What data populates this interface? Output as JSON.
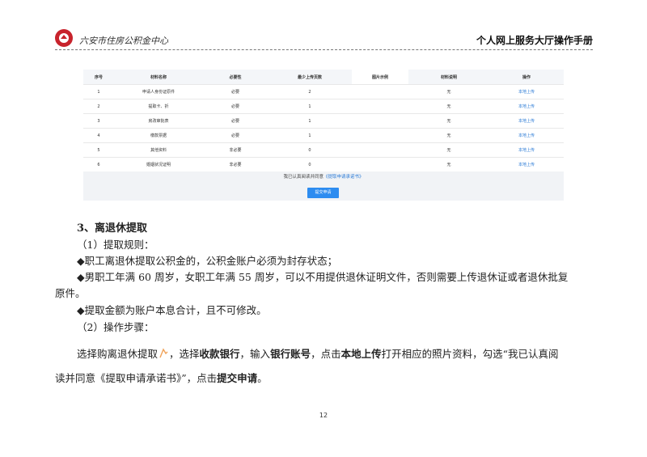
{
  "header": {
    "org_name": "六安市住房公积金中心",
    "doc_title": "个人网上服务大厅操作手册"
  },
  "screenshot": {
    "columns": [
      "序号",
      "材料名称",
      "必要性",
      "最少上传页数",
      "图片示例",
      "材料说明",
      "操作"
    ],
    "rows": [
      {
        "no": "1",
        "name": "申请人身份证原件",
        "required": "必要",
        "min_pages": "2",
        "desc": "无",
        "action": "本地上传"
      },
      {
        "no": "2",
        "name": "提取卡、折",
        "required": "必要",
        "min_pages": "1",
        "desc": "无",
        "action": "本地上传"
      },
      {
        "no": "3",
        "name": "房改审批表",
        "required": "必要",
        "min_pages": "1",
        "desc": "无",
        "action": "本地上传"
      },
      {
        "no": "4",
        "name": "缴款票据",
        "required": "必要",
        "min_pages": "1",
        "desc": "无",
        "action": "本地上传"
      },
      {
        "no": "5",
        "name": "其他资料",
        "required": "非必要",
        "min_pages": "0",
        "desc": "无",
        "action": "本地上传"
      },
      {
        "no": "6",
        "name": "婚姻状况证明",
        "required": "非必要",
        "min_pages": "0",
        "desc": "无",
        "action": "本地上传"
      }
    ],
    "agree_prefix": "我已认真阅读并同意",
    "agree_link": "《提取申请承诺书》",
    "submit_label": "提交申请"
  },
  "body": {
    "section_title": "3、离退休提取",
    "rule_heading": "（1）提取规则：",
    "bullet1": "◆职工离退休提取公积金的，公积金账户必须为封存状态；",
    "bullet2_line1": "◆男职工年满 60 周岁，女职工年满 55 周岁，可以不用提供退休证明文件，否则需要上传退休证或者退休批复",
    "bullet2_line2": "原件。",
    "bullet3": "◆提取金额为账户本息合计，且不可修改。",
    "steps_heading": "（2）操作步骤：",
    "steps": {
      "t1": "选择购离退休提取",
      "t2": "，选择",
      "b1": "收款银行",
      "t3": "，输入",
      "b2": "银行账号",
      "t4": "，点击",
      "b3": "本地上传",
      "t5": "打开相应的照片资料，勾选“我已认真阅",
      "line2_t1": "读并同意《提取申请承诺书》”，点击",
      "line2_b1": "提交申请",
      "line2_t2": "。"
    }
  },
  "page_number": "12"
}
